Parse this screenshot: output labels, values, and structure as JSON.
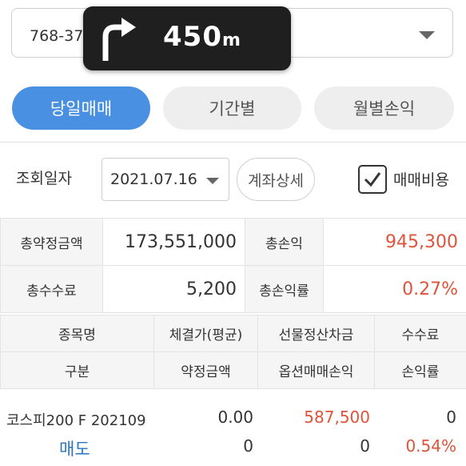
{
  "account": {
    "text": "768-379 · 52-[옵션] 이환수"
  },
  "nav": {
    "distance": "450",
    "unit": "m"
  },
  "tabs": [
    {
      "label": "당일매매"
    },
    {
      "label": "기간별"
    },
    {
      "label": "월별손익"
    }
  ],
  "query": {
    "label": "조회일자",
    "date": "2021.07.16",
    "detail_button": "계좌상세",
    "checkbox_label": "매매비용",
    "checkbox_checked": true
  },
  "summary": {
    "total_contract_label": "총약정금액",
    "total_contract_value": "173,551,000",
    "total_pl_label": "총손익",
    "total_pl_value": "945,300",
    "total_fee_label": "총수수료",
    "total_fee_value": "5,200",
    "total_pl_rate_label": "총손익률",
    "total_pl_rate_value": "0.27%"
  },
  "headers": {
    "row1": [
      "종목명",
      "체결가(평균)",
      "선물정산차금",
      "수수료"
    ],
    "row2": [
      "구분",
      "약정금액",
      "옵션매매손익",
      "손익률"
    ]
  },
  "rows": [
    {
      "name": "코스피200 F 202109",
      "price": "0.00",
      "futures_settlement": "587,500",
      "fee": "0",
      "type": "매도",
      "contract_amount": "0",
      "option_pl": "0",
      "pl_rate": "0.54%"
    }
  ],
  "colors": {
    "accent": "#4a90e2",
    "loss_red": "#e0533b",
    "sell_blue": "#2a76c4"
  }
}
